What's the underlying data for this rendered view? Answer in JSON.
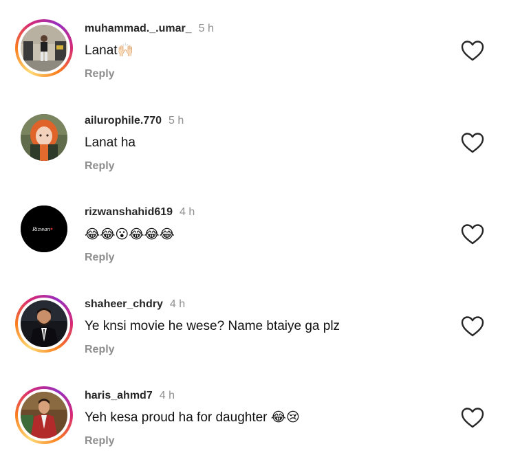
{
  "comments": [
    {
      "username": "muhammad._.umar_",
      "time": "5 h",
      "text": "Lanat🙌🏻",
      "reply_label": "Reply",
      "avatar_icon": "person-photo-avatar",
      "has_story_ring": true
    },
    {
      "username": "ailurophile.770",
      "time": "5 h",
      "text": "Lanat ha",
      "reply_label": "Reply",
      "avatar_icon": "orange-hair-girl-avatar",
      "has_story_ring": false
    },
    {
      "username": "rizwanshahid619",
      "time": "4 h",
      "text": "😂😂😮😂😂😂",
      "reply_label": "Reply",
      "avatar_icon": "black-signature-avatar",
      "avatar_signature": "Rizwan",
      "has_story_ring": false
    },
    {
      "username": "shaheer_chdry",
      "time": "4 h",
      "text": "Ye knsi movie he wese? Name btaiye ga plz",
      "reply_label": "Reply",
      "avatar_icon": "man-in-suit-avatar",
      "has_story_ring": true
    },
    {
      "username": "haris_ahmd7",
      "time": "4 h",
      "text": "Yeh kesa proud ha for daughter 😂😢",
      "reply_label": "Reply",
      "avatar_icon": "man-in-red-jacket-avatar",
      "has_story_ring": true
    }
  ],
  "colors": {
    "username": "#262626",
    "meta_gray": "#8e8e8e",
    "heart_outline": "#262626"
  },
  "icons": {
    "like": "heart-outline-icon"
  }
}
